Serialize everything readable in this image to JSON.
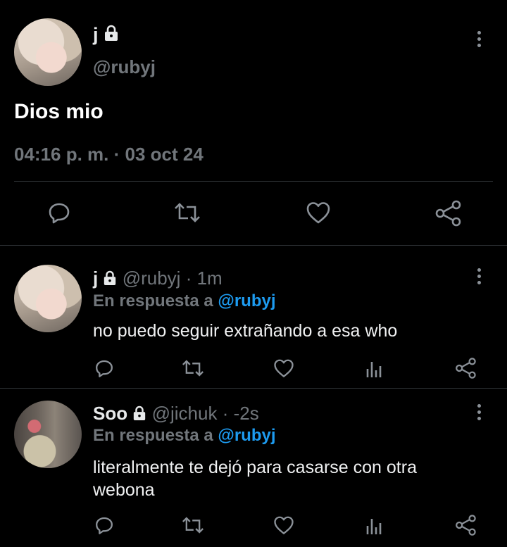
{
  "main_tweet": {
    "display_name": "j",
    "handle": "@rubyj",
    "text": "Dios mio",
    "timestamp": "04:16 p. m. · 03 oct 24"
  },
  "replies": [
    {
      "display_name": "j",
      "handle": "@rubyj",
      "time": "· 1m",
      "reply_prefix": "En respuesta a",
      "reply_to": "@rubyj",
      "text": "no puedo seguir extrañando a esa who"
    },
    {
      "display_name": "Soo",
      "handle": "@jichuk",
      "time": "· -2s",
      "reply_prefix": "En respuesta a",
      "reply_to": "@rubyj",
      "text_line1": "literalmente te dejó para casarse con otra",
      "text_line2": "webona"
    }
  ],
  "icons": {
    "lock": "lock-icon",
    "more": "more-vertical-icon",
    "reply": "reply-icon",
    "retweet": "retweet-icon",
    "like": "heart-icon",
    "views": "views-icon",
    "share": "share-icon"
  },
  "colors": {
    "background": "#000000",
    "text": "#e7e9ea",
    "muted": "#71767b",
    "link": "#1d9bf0",
    "divider": "#2f3336"
  }
}
